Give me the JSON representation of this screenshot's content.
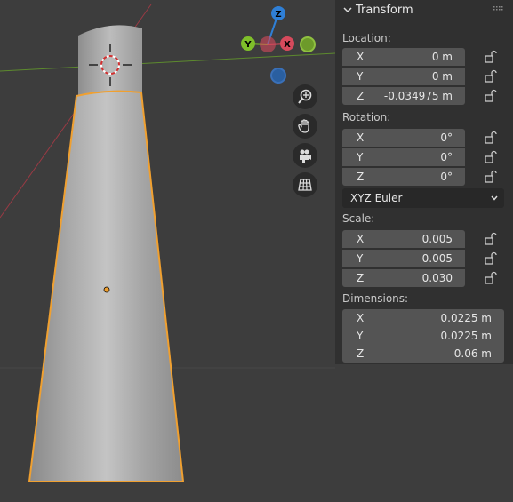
{
  "panel": {
    "title": "Transform",
    "location": {
      "label": "Location:",
      "x": {
        "axis": "X",
        "value": "0 m"
      },
      "y": {
        "axis": "Y",
        "value": "0 m"
      },
      "z": {
        "axis": "Z",
        "value": "-0.034975 m"
      }
    },
    "rotation": {
      "label": "Rotation:",
      "x": {
        "axis": "X",
        "value": "0°"
      },
      "y": {
        "axis": "Y",
        "value": "0°"
      },
      "z": {
        "axis": "Z",
        "value": "0°"
      },
      "mode": "XYZ Euler"
    },
    "scale": {
      "label": "Scale:",
      "x": {
        "axis": "X",
        "value": "0.005"
      },
      "y": {
        "axis": "Y",
        "value": "0.005"
      },
      "z": {
        "axis": "Z",
        "value": "0.030"
      }
    },
    "dimensions": {
      "label": "Dimensions:",
      "x": {
        "axis": "X",
        "value": "0.0225 m"
      },
      "y": {
        "axis": "Y",
        "value": "0.0225 m"
      },
      "z": {
        "axis": "Z",
        "value": "0.06 m"
      }
    }
  },
  "gizmo": {
    "z_label": "Z",
    "y_label": "Y",
    "x_label": "X",
    "colors": {
      "x": "#d64a5c",
      "y": "#7fbf2a",
      "z": "#2f7fd6"
    }
  },
  "viewport": {
    "selection_color": "#f0a030",
    "icons": [
      "zoom-icon",
      "hand-pan-icon",
      "camera-icon",
      "grid-view-icon"
    ]
  }
}
